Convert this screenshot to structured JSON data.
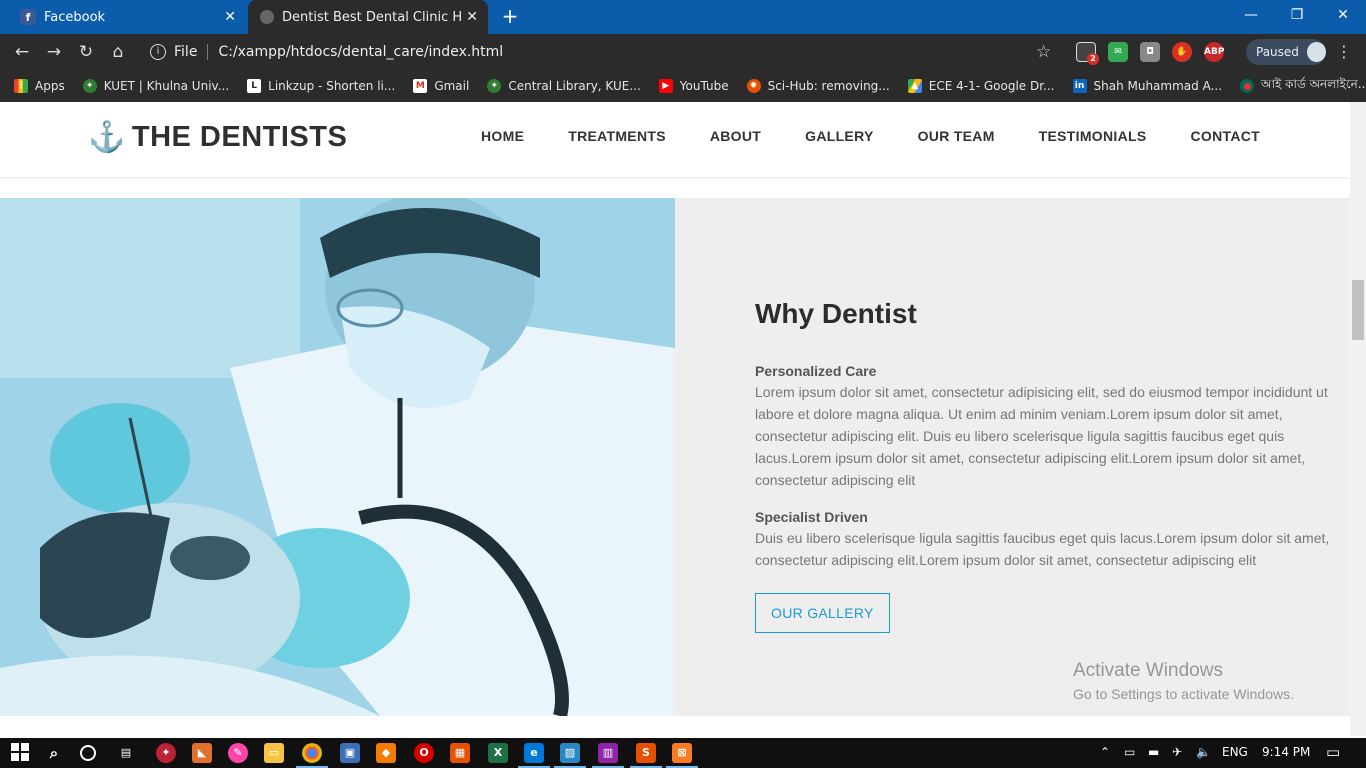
{
  "browser": {
    "tabs": [
      {
        "label": "Facebook",
        "icon": "facebook-icon",
        "color": "#3b5998"
      },
      {
        "label": "Dentist Best Dental Clinic HTML \\",
        "icon": "globe-icon"
      }
    ],
    "new_tab": "+",
    "window": {
      "minimize": "—",
      "restore": "❐",
      "close": "✕"
    },
    "address": {
      "scheme_label": "File",
      "url": "C:/xampp/htdocs/dental_care/index.html"
    },
    "profile": {
      "status": "Paused"
    },
    "extensions": [
      {
        "name": "extension-icon",
        "badge": "2"
      },
      {
        "name": "mail-extension-icon"
      },
      {
        "name": "camera-extension-icon"
      },
      {
        "name": "stop-extension-icon"
      },
      {
        "name": "adblock-icon",
        "label": "ABP"
      }
    ],
    "bookmarks": [
      {
        "label": "Apps",
        "icon": "apps-grid-icon"
      },
      {
        "label": "KUET | Khulna Univ...",
        "icon": "kuet-shield-icon"
      },
      {
        "label": "Linkzup - Shorten li...",
        "icon": "linkzup-icon"
      },
      {
        "label": "Gmail",
        "icon": "gmail-icon"
      },
      {
        "label": "Central Library, KUE...",
        "icon": "kuet-shield-icon"
      },
      {
        "label": "YouTube",
        "icon": "youtube-icon"
      },
      {
        "label": "Sci-Hub: removing...",
        "icon": "scihub-icon"
      },
      {
        "label": "ECE 4-1- Google Dr...",
        "icon": "google-drive-icon"
      },
      {
        "label": "Shah Muhammad A...",
        "icon": "linkedin-icon"
      },
      {
        "label": "আই কার্ড অনলাইনে...",
        "icon": "bd-flag-icon"
      }
    ]
  },
  "site": {
    "brand": "THE DENTISTS",
    "nav": [
      "HOME",
      "TREATMENTS",
      "ABOUT",
      "GALLERY",
      "OUR TEAM",
      "TESTIMONIALS",
      "CONTACT"
    ],
    "accent_color": "#1a9ad6",
    "section": {
      "title": "Why Dentist",
      "blocks": [
        {
          "heading": "Personalized Care",
          "body": "Lorem ipsum dolor sit amet, consectetur adipisicing elit, sed do eiusmod tempor incididunt ut labore et dolore magna aliqua. Ut enim ad minim veniam.Lorem ipsum dolor sit amet, consectetur adipiscing elit. Duis eu libero scelerisque ligula sagittis faucibus eget quis lacus.Lorem ipsum dolor sit amet, consectetur adipiscing elit.Lorem ipsum dolor sit amet, consectetur adipiscing elit"
        },
        {
          "heading": "Specialist Driven",
          "body": "Duis eu libero scelerisque ligula sagittis faucibus eget quis lacus.Lorem ipsum dolor sit amet, consectetur adipiscing elit.Lorem ipsum dolor sit amet, consectetur adipiscing elit"
        }
      ],
      "button": "OUR GALLERY"
    }
  },
  "watermark": {
    "line1": "Activate Windows",
    "line2": "Go to Settings to activate Windows."
  },
  "taskbar": {
    "apps": [
      "start-icon",
      "search-icon",
      "cortana-icon",
      "task-view-icon",
      "app-icon",
      "matlab-icon",
      "paint-icon",
      "file-explorer-icon",
      "chrome-icon",
      "app-icon",
      "app-icon",
      "opera-icon",
      "app-icon",
      "excel-icon",
      "edge-icon",
      "photos-icon",
      "winrar-icon",
      "sublime-icon",
      "xampp-icon"
    ],
    "language": "ENG",
    "time": "9:14 PM"
  }
}
